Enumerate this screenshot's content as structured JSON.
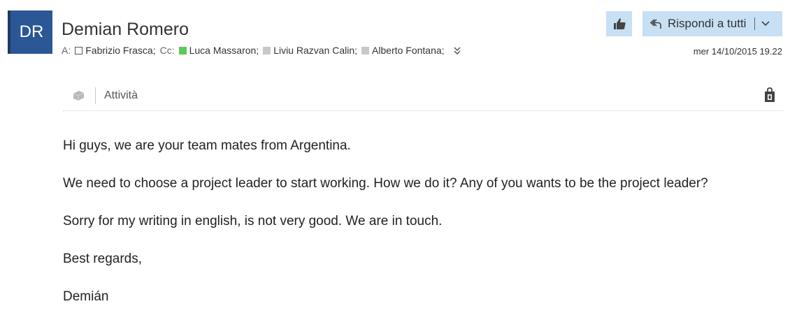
{
  "avatar": {
    "initials": "DR",
    "color": "#2b5797"
  },
  "sender": {
    "name": "Demian Romero"
  },
  "recipients": {
    "to_label": "A:",
    "to": [
      {
        "name": "Fabrizio Frasca;",
        "status": "none"
      }
    ],
    "cc_label": "Cc:",
    "cc": [
      {
        "name": "Luca Massaron;",
        "status": "online",
        "color": "#5cc85c"
      },
      {
        "name": "Liviu Razvan Calin;",
        "status": "unknown",
        "color": "#c8c8c8"
      },
      {
        "name": "Alberto Fontana;",
        "status": "unknown",
        "color": "#c8c8c8"
      }
    ],
    "expand_icon": "chevron-double-down-icon"
  },
  "toolbar": {
    "like_icon": "thumbs-up-icon",
    "reply_all_label": "Rispondi a tutti",
    "reply_icon": "reply-all-icon",
    "dropdown_icon": "chevron-down-icon",
    "button_color": "#c7e0f4"
  },
  "date": "mer 14/10/2015 19.22",
  "activity": {
    "label": "Attività",
    "addin_icon": "addin-icon",
    "store_icon": "store-bag-icon"
  },
  "message": {
    "paragraphs": [
      "Hi guys, we are your team mates from Argentina.",
      "We need to choose a project leader to start working. How we do it? Any of you wants to be the project leader?",
      "Sorry for my writing in english, is not very good. We are in touch.",
      "Best regards,",
      "Demián"
    ]
  }
}
